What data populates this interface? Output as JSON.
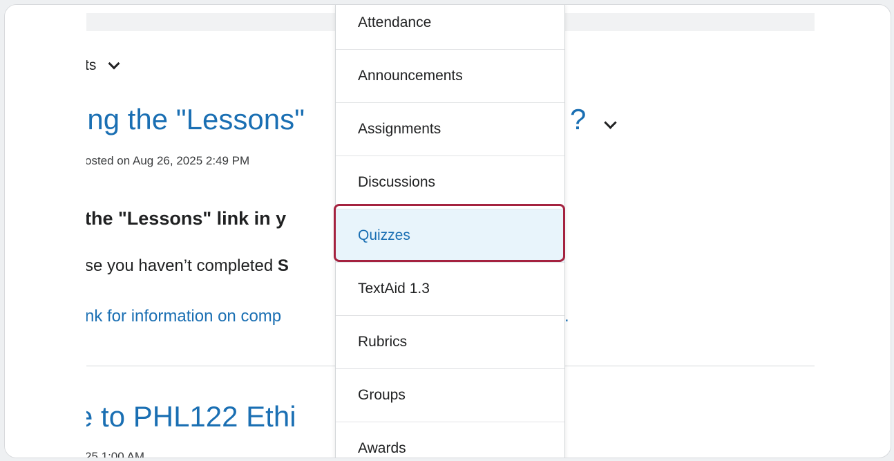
{
  "page": {
    "section_header": "ts",
    "post1": {
      "title": "ing the \"Lessons\"",
      "title_tail": "?",
      "meta": "osted on Aug 26, 2025 2:49 PM",
      "heading": "the \"Lessons\" link in y",
      "line_before_bold": "se you haven’t completed ",
      "line_bold": "S",
      "link_text": "nk for information on comp",
      "link_tail": "."
    },
    "post2": {
      "title": "e to PHL122 Ethi",
      "meta": "25 1:00 AM"
    }
  },
  "dropdown": {
    "items": [
      {
        "label": "Attendance"
      },
      {
        "label": "Announcements"
      },
      {
        "label": "Assignments"
      },
      {
        "label": "Discussions"
      },
      {
        "label": "Quizzes",
        "selected": true
      },
      {
        "label": "TextAid 1.3"
      },
      {
        "label": "Rubrics"
      },
      {
        "label": "Groups"
      },
      {
        "label": "Awards"
      }
    ]
  },
  "colors": {
    "link_blue": "#1a6fb3",
    "highlight_border": "#a4223f",
    "selected_bg": "#e8f4fb"
  }
}
